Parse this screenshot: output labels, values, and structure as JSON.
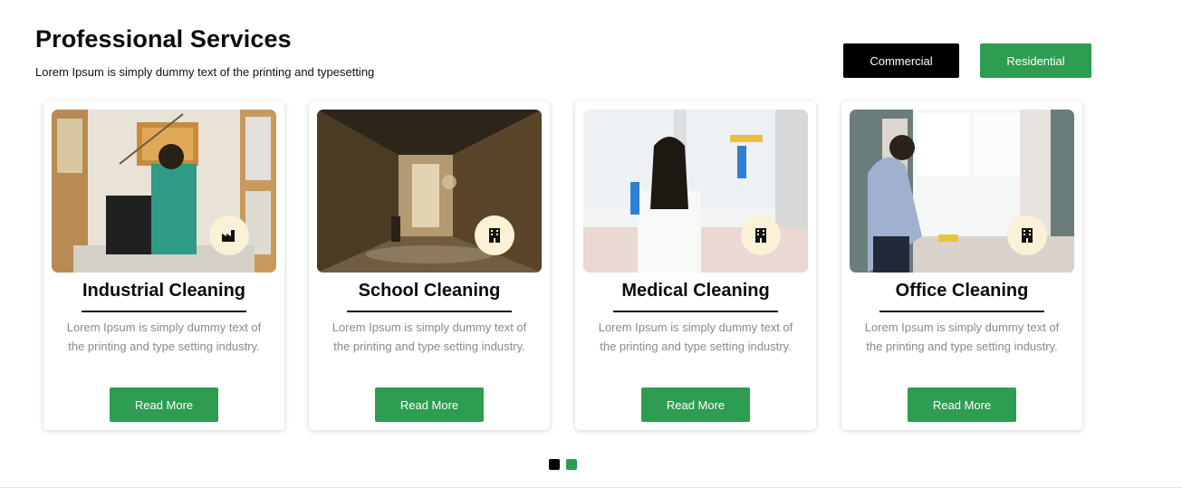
{
  "section": {
    "title": "Professional Services",
    "subtitle": "Lorem Ipsum is simply dummy text of the printing and typesetting"
  },
  "tabs": {
    "commercial_label": "Commercial",
    "residential_label": "Residential"
  },
  "cards": [
    {
      "title": "Industrial Cleaning",
      "description": "Lorem Ipsum is simply dummy text of the printing and type setting industry.",
      "button_label": "Read More",
      "badge_icon": "factory-icon"
    },
    {
      "title": "School Cleaning",
      "description": "Lorem Ipsum is simply dummy text of the printing and type setting industry.",
      "button_label": "Read More",
      "badge_icon": "building-icon"
    },
    {
      "title": "Medical Cleaning",
      "description": "Lorem Ipsum is simply dummy text of the printing and type setting industry.",
      "button_label": "Read More",
      "badge_icon": "building-icon"
    },
    {
      "title": "Office Cleaning",
      "description": "Lorem Ipsum is simply dummy text of the printing and type setting industry.",
      "button_label": "Read More",
      "badge_icon": "building-icon"
    }
  ],
  "carousel": {
    "page_count": 2,
    "active_page": 1
  },
  "colors": {
    "accent_green": "#2e9c51",
    "black": "#000000",
    "badge_bg": "#fbf1d6",
    "muted_text": "#8a8a8a"
  }
}
